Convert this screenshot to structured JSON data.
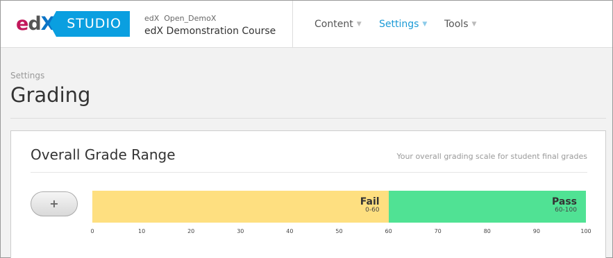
{
  "header": {
    "logo": {
      "brand_ed": "e",
      "brand_d": "d",
      "brand_x": "X",
      "studio_label": "STUDIO"
    },
    "course_org": "edX  Open_DemoX",
    "course_title": "edX Demonstration Course",
    "nav": [
      {
        "label": "Content",
        "active": false
      },
      {
        "label": "Settings",
        "active": true
      },
      {
        "label": "Tools",
        "active": false
      }
    ]
  },
  "breadcrumb": "Settings",
  "page_title": "Grading",
  "grade_range": {
    "title": "Overall Grade Range",
    "subtitle": "Your overall grading scale for student final grades",
    "add_button_label": "+",
    "segments": [
      {
        "name": "Fail",
        "range": "0-60",
        "start": 0,
        "end": 60,
        "color": "#fedf80"
      },
      {
        "name": "Pass",
        "range": "60-100",
        "start": 60,
        "end": 100,
        "color": "#50e294"
      }
    ],
    "axis_ticks": [
      "0",
      "10",
      "20",
      "30",
      "40",
      "50",
      "60",
      "70",
      "80",
      "90",
      "100"
    ]
  }
}
